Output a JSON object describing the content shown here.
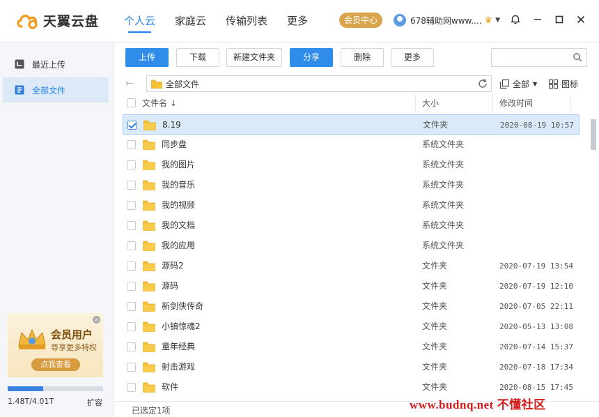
{
  "app": {
    "name": "天翼云盘",
    "nav": [
      "个人云",
      "家庭云",
      "传输列表",
      "更多"
    ],
    "vip_center": "会员中心",
    "username": "678辅助网www....",
    "colors": {
      "accent": "#1e82e8",
      "vip": "#d9a44c",
      "folder": "#f5c13b"
    }
  },
  "sidebar": {
    "items": [
      {
        "label": "最近上传",
        "icon": "recent-upload-icon"
      },
      {
        "label": "全部文件",
        "icon": "all-files-icon"
      }
    ],
    "promo": {
      "title": "会员用户",
      "subtitle": "尊享更多特权",
      "button": "点我查看"
    },
    "storage": {
      "text": "1.48T/4.01T",
      "used_fraction": 0.37,
      "expand": "扩容"
    }
  },
  "toolbar": {
    "upload": "上传",
    "download": "下载",
    "new_folder": "新建文件夹",
    "share": "分享",
    "delete": "删除",
    "more": "更多",
    "search_placeholder": ""
  },
  "pathbar": {
    "path": "全部文件",
    "filter": "全部",
    "view": "图标"
  },
  "columns": {
    "name": "文件名",
    "size": "大小",
    "modified": "修改时间"
  },
  "files": [
    {
      "name": "8.19",
      "type": "文件夹",
      "date": "2020-08-19 10:57",
      "selected": true
    },
    {
      "name": "同步盘",
      "type": "系统文件夹",
      "date": ""
    },
    {
      "name": "我的图片",
      "type": "系统文件夹",
      "date": ""
    },
    {
      "name": "我的音乐",
      "type": "系统文件夹",
      "date": ""
    },
    {
      "name": "我的视频",
      "type": "系统文件夹",
      "date": ""
    },
    {
      "name": "我的文档",
      "type": "系统文件夹",
      "date": ""
    },
    {
      "name": "我的应用",
      "type": "系统文件夹",
      "date": ""
    },
    {
      "name": "源码2",
      "type": "文件夹",
      "date": "2020-07-19 13:54"
    },
    {
      "name": "源码",
      "type": "文件夹",
      "date": "2020-07-19 12:10"
    },
    {
      "name": "新剑侠传奇",
      "type": "文件夹",
      "date": "2020-07-05 22:11"
    },
    {
      "name": "小镇惊魂2",
      "type": "文件夹",
      "date": "2020-05-13 13:08"
    },
    {
      "name": "童年经典",
      "type": "文件夹",
      "date": "2020-07-14 15:37"
    },
    {
      "name": "射击游戏",
      "type": "文件夹",
      "date": "2020-07-18 17:34"
    },
    {
      "name": "软件",
      "type": "文件夹",
      "date": "2020-08-15 17:45"
    }
  ],
  "status": {
    "selected_text": "已选定1项"
  },
  "watermark": "www.budnq.net 不懂社区"
}
